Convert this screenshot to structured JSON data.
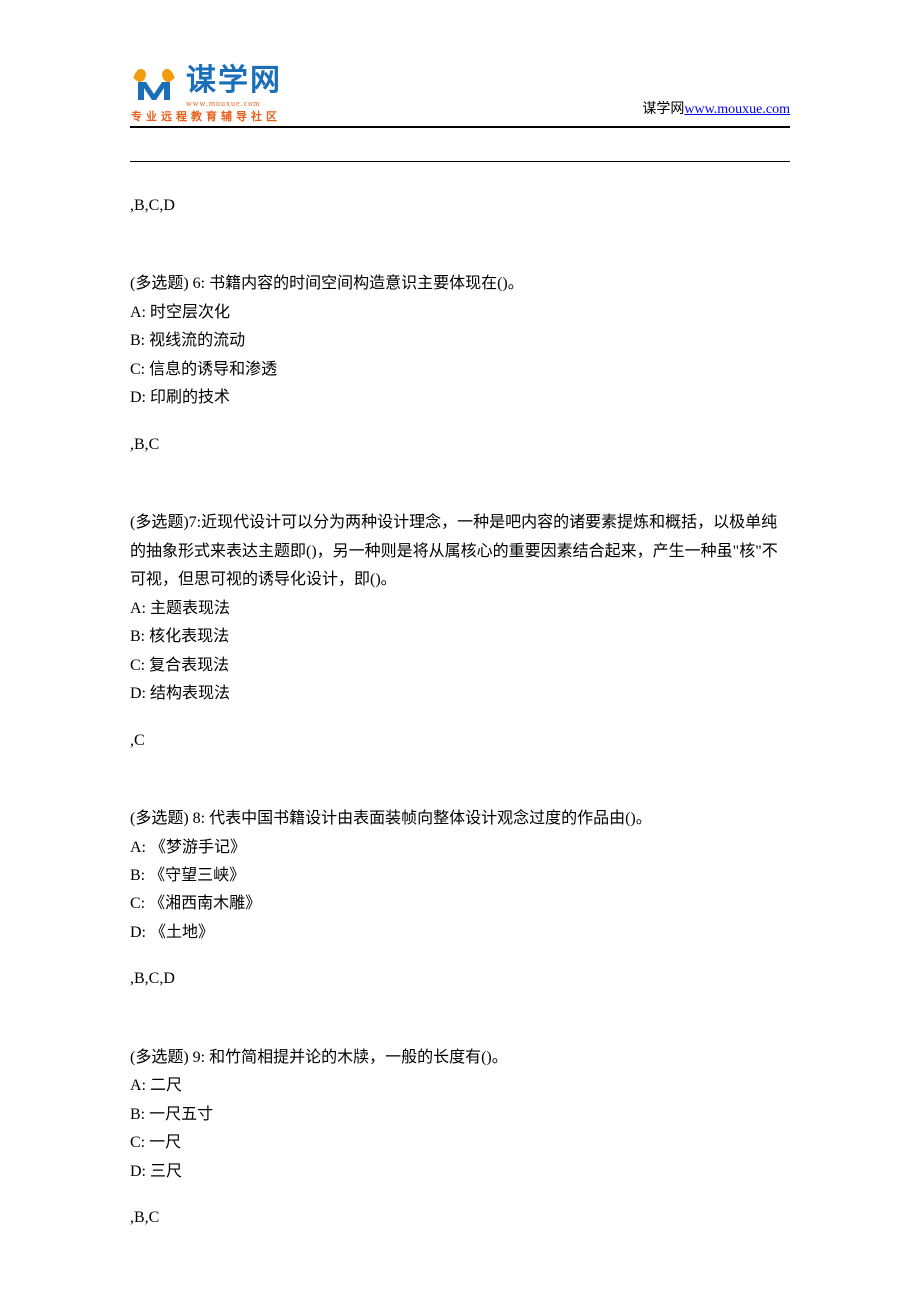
{
  "header": {
    "logo_text": "谋学网",
    "logo_url_small": "www.mouxue.com",
    "tagline": "专业远程教育辅导社区",
    "right_text": "谋学网",
    "right_link": "www.mouxue.com"
  },
  "prev_answer": ",B,C,D",
  "questions": [
    {
      "prompt": "(多选题) 6: 书籍内容的时间空间构造意识主要体现在()。",
      "options": [
        "A: 时空层次化",
        "B: 视线流的流动",
        "C: 信息的诱导和渗透",
        "D: 印刷的技术"
      ],
      "answer": ",B,C"
    },
    {
      "prompt": "(多选题)7:近现代设计可以分为两种设计理念，一种是吧内容的诸要素提炼和概括，以极单纯的抽象形式来表达主题即()，另一种则是将从属核心的重要因素结合起来，产生一种虽\"核\"不可视，但思可视的诱导化设计，即()。",
      "options": [
        "A: 主题表现法",
        "B: 核化表现法",
        "C: 复合表现法",
        "D: 结构表现法"
      ],
      "answer": ",C"
    },
    {
      "prompt": "(多选题) 8: 代表中国书籍设计由表面装帧向整体设计观念过度的作品由()。",
      "options": [
        "A: 《梦游手记》",
        "B: 《守望三峡》",
        "C: 《湘西南木雕》",
        "D: 《土地》"
      ],
      "answer": ",B,C,D"
    },
    {
      "prompt": "(多选题) 9: 和竹简相提并论的木牍，一般的长度有()。",
      "options": [
        "A: 二尺",
        "B: 一尺五寸",
        "C: 一尺",
        "D: 三尺"
      ],
      "answer": ",B,C"
    }
  ]
}
